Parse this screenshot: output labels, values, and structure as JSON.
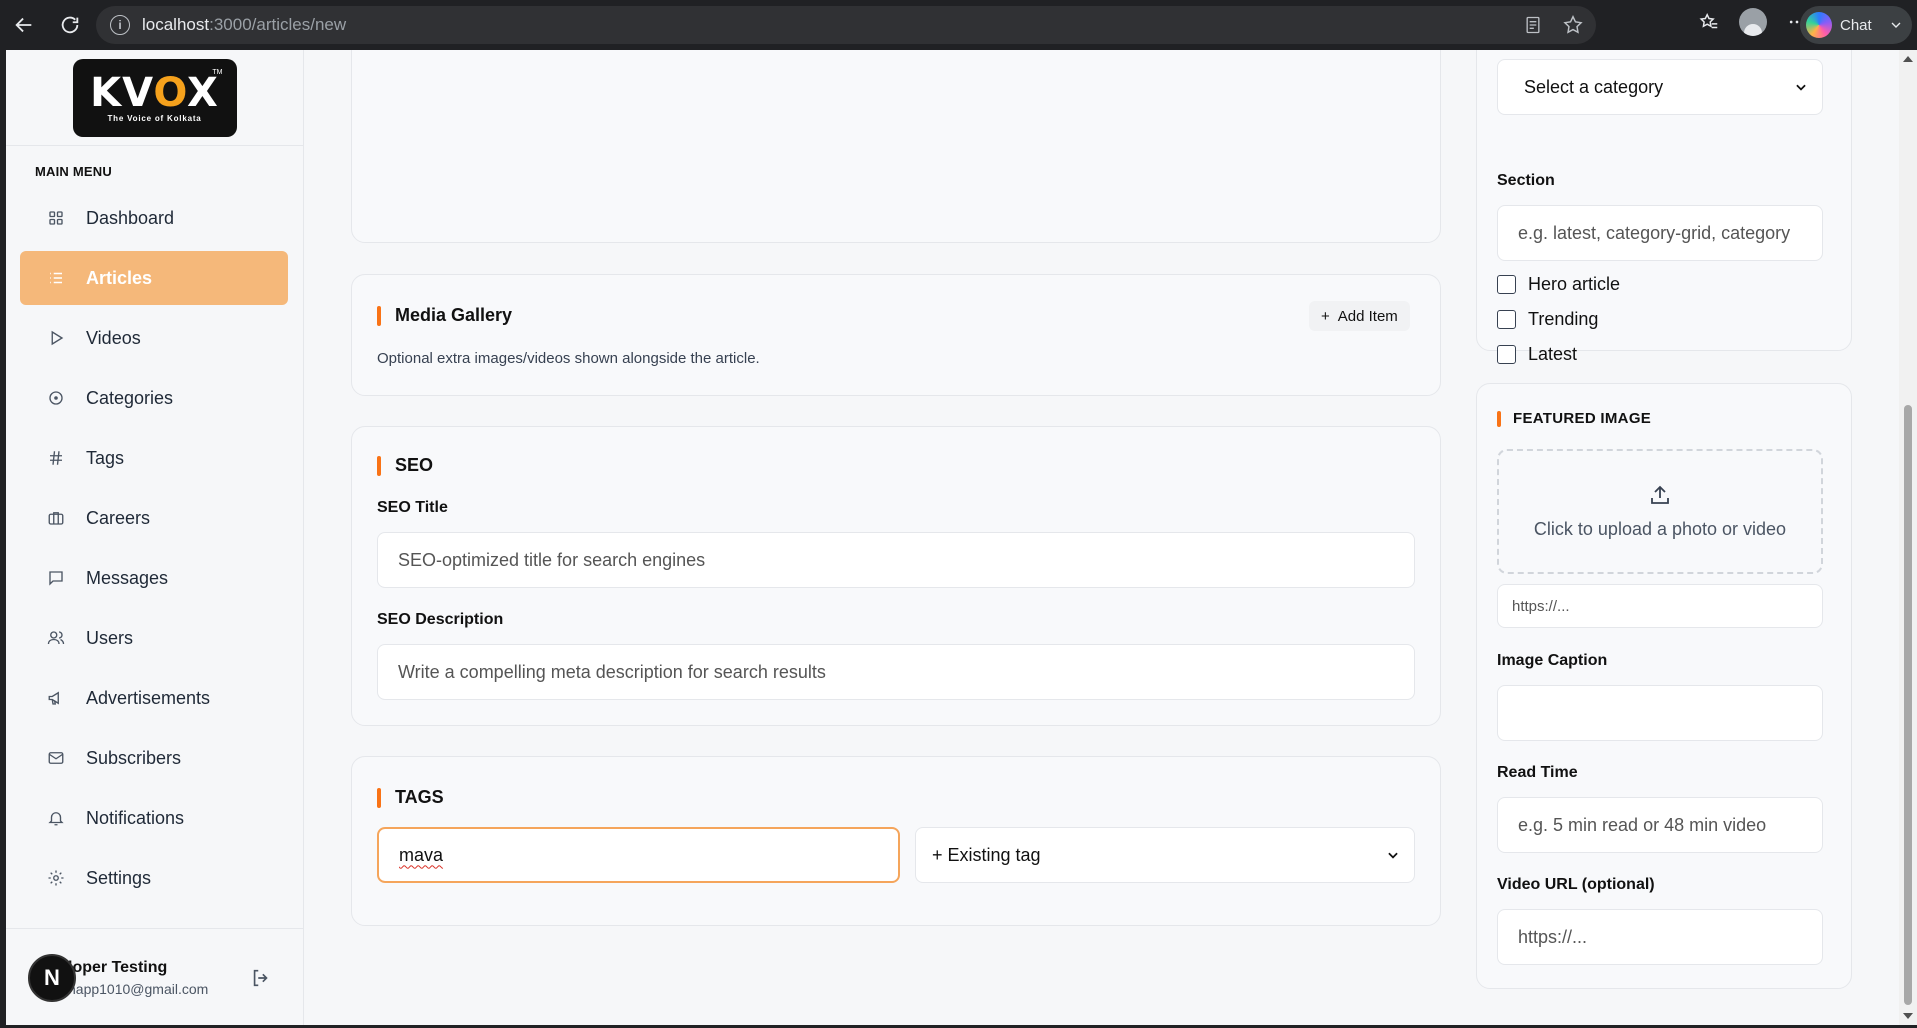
{
  "browser": {
    "url_host": "localhost",
    "url_path": ":3000/articles/new",
    "chat_label": "Chat"
  },
  "sidebar": {
    "logo": {
      "word_a": "KV",
      "word_o": "O",
      "word_x": "X",
      "tm": "TM",
      "tagline": "The Voice of Kolkata"
    },
    "menu_title": "MAIN MENU",
    "items": [
      {
        "label": "Dashboard",
        "icon": "grid-icon"
      },
      {
        "label": "Articles",
        "icon": "list-icon",
        "active": true
      },
      {
        "label": "Videos",
        "icon": "play-icon"
      },
      {
        "label": "Categories",
        "icon": "circle-dot-icon"
      },
      {
        "label": "Tags",
        "icon": "hash-icon"
      },
      {
        "label": "Careers",
        "icon": "briefcase-icon"
      },
      {
        "label": "Messages",
        "icon": "message-icon"
      },
      {
        "label": "Users",
        "icon": "users-icon"
      },
      {
        "label": "Advertisements",
        "icon": "megaphone-icon"
      },
      {
        "label": "Subscribers",
        "icon": "mail-icon"
      },
      {
        "label": "Notifications",
        "icon": "bell-icon"
      },
      {
        "label": "Settings",
        "icon": "gear-icon"
      }
    ],
    "user": {
      "avatar_letter": "N",
      "name": "loper Testing",
      "email": "napp1010@gmail.com"
    }
  },
  "media_gallery": {
    "title": "Media Gallery",
    "add_label": "Add Item",
    "hint": "Optional extra images/videos shown alongside the article."
  },
  "seo": {
    "title": "SEO",
    "seo_title_label": "SEO Title",
    "seo_title_placeholder": "SEO-optimized title for search engines",
    "seo_desc_label": "SEO Description",
    "seo_desc_placeholder": "Write a compelling meta description for search results"
  },
  "tags": {
    "title": "TAGS",
    "input_value": "mava",
    "existing_label": "+ Existing tag"
  },
  "right_panel": {
    "category_select": "Select a category",
    "section_label": "Section",
    "section_placeholder": "e.g. latest, category-grid, category",
    "checkboxes": [
      "Hero article",
      "Trending",
      "Latest"
    ]
  },
  "featured": {
    "title": "FEATURED IMAGE",
    "upload_text": "Click to upload a photo or video",
    "url_placeholder": "https://...",
    "caption_label": "Image Caption",
    "read_time_label": "Read Time",
    "read_time_placeholder": "e.g. 5 min read or 48 min video",
    "video_url_label": "Video URL (optional)",
    "video_url_placeholder": "https://..."
  }
}
